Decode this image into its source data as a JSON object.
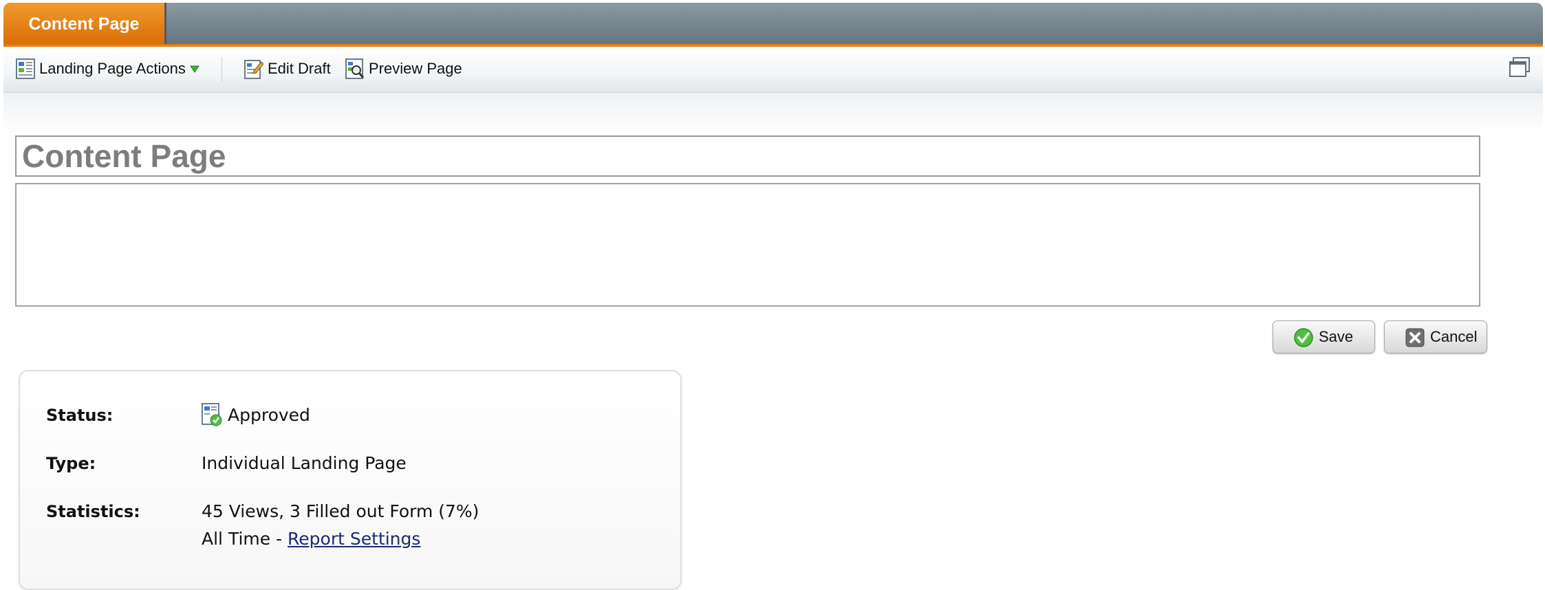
{
  "header": {
    "tab_label": "Content Page"
  },
  "toolbar": {
    "actions_label": "Landing Page Actions",
    "edit_label": "Edit Draft",
    "preview_label": "Preview Page"
  },
  "editor": {
    "title_value": "Content Page",
    "body_value": ""
  },
  "buttons": {
    "save_label": "Save",
    "cancel_label": "Cancel"
  },
  "info": {
    "status_label": "Status:",
    "status_value": "Approved",
    "type_label": "Type:",
    "type_value": "Individual Landing Page",
    "stats_label": "Statistics:",
    "stats_value": "45 Views, 3 Filled out Form (7%)",
    "period_prefix": "All Time - ",
    "report_link": "Report Settings"
  },
  "colors": {
    "accent": "#e87d14",
    "header": "#7a8891",
    "link": "#1a2a6c"
  },
  "icons": [
    "landing-page-icon",
    "dropdown-triangle-icon",
    "edit-draft-icon",
    "preview-page-icon",
    "restore-window-icon",
    "save-check-icon",
    "cancel-x-icon",
    "approved-status-icon"
  ]
}
